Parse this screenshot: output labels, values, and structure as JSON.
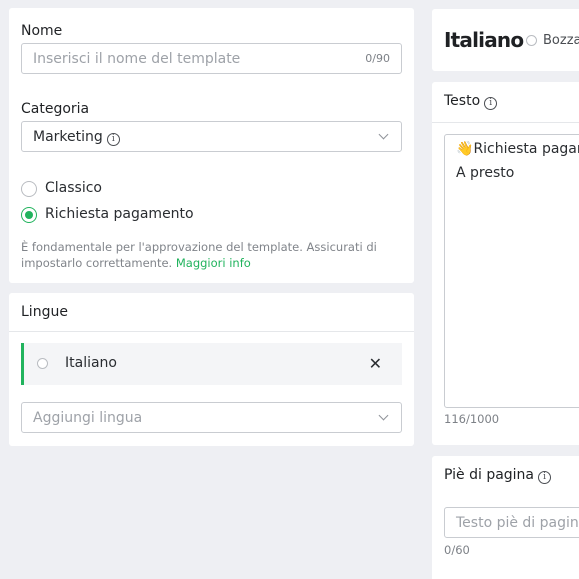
{
  "form": {
    "name": {
      "label": "Nome",
      "placeholder": "Inserisci il nome del template",
      "counter": "0/90"
    },
    "category": {
      "label": "Categoria",
      "selected": "Marketing",
      "options": [
        {
          "label": "Classico",
          "checked": false
        },
        {
          "label": "Richiesta pagamento",
          "checked": true
        }
      ],
      "help_text": "È fondamentale per l'approvazione del template. Assicurati di impostarlo correttamente.",
      "help_link": "Maggiori info"
    }
  },
  "languages": {
    "title": "Lingue",
    "items": [
      {
        "label": "Italiano"
      }
    ],
    "add_placeholder": "Aggiungi lingua"
  },
  "editor": {
    "language": "Italiano",
    "status": "Bozza",
    "text": {
      "label": "Testo",
      "emoji": "👋",
      "line1": "Richiesta pagam",
      "line2": "A presto",
      "counter": "116/1000"
    },
    "footer": {
      "label": "Piè di pagina",
      "placeholder": "Testo piè di pagina i",
      "counter": "0/60"
    }
  },
  "colors": {
    "accent": "#21b35d",
    "background": "#eeeff3",
    "card": "#ffffff"
  },
  "icons": {
    "info": "info-icon",
    "dropdown": "chevron-down-icon",
    "remove": "close-icon",
    "status": "circle-icon"
  }
}
